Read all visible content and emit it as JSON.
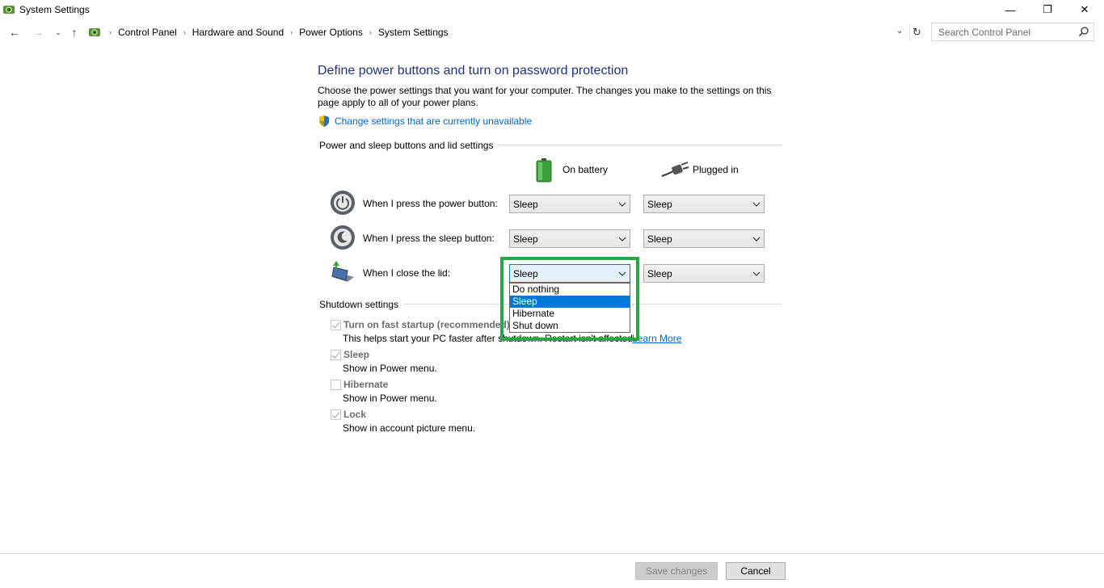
{
  "window": {
    "title": "System Settings",
    "minimize_glyph": "—",
    "maximize_glyph": "❐",
    "close_glyph": "✕"
  },
  "navigation": {
    "back_glyph": "←",
    "forward_glyph": "→",
    "recent_glyph": "⌄",
    "up_glyph": "↑",
    "breadcrumbs": [
      "Control Panel",
      "Hardware and Sound",
      "Power Options",
      "System Settings"
    ],
    "separator": "›",
    "dropdown_glyph": "⌄",
    "refresh_glyph": "↻"
  },
  "search": {
    "placeholder": "Search Control Panel",
    "icon": "search-icon"
  },
  "main": {
    "title": "Define power buttons and turn on password protection",
    "description": "Choose the power settings that you want for your computer. The changes you make to the settings on this page apply to all of your power plans.",
    "change_link": "Change settings that are currently unavailable"
  },
  "power_section": {
    "header": "Power and sleep buttons and lid settings",
    "columns": {
      "battery": "On battery",
      "plugged": "Plugged in"
    },
    "rows": [
      {
        "label": "When I press the power button:",
        "battery": "Sleep",
        "plugged": "Sleep",
        "icon": "power-button-icon"
      },
      {
        "label": "When I press the sleep button:",
        "battery": "Sleep",
        "plugged": "Sleep",
        "icon": "sleep-button-icon"
      },
      {
        "label": "When I close the lid:",
        "battery": "Sleep",
        "plugged": "Sleep",
        "icon": "laptop-lid-icon"
      }
    ],
    "open_dropdown": {
      "options": [
        "Do nothing",
        "Sleep",
        "Hibernate",
        "Shut down"
      ],
      "selected": "Sleep"
    }
  },
  "shutdown_section": {
    "header": "Shutdown settings",
    "items": [
      {
        "label": "Turn on fast startup (recommended)",
        "checked": true,
        "description": "This helps start your PC faster after shutdown. Restart isn't affected.",
        "link": "Learn More"
      },
      {
        "label": "Sleep",
        "checked": true,
        "description": "Show in Power menu."
      },
      {
        "label": "Hibernate",
        "checked": false,
        "description": "Show in Power menu."
      },
      {
        "label": "Lock",
        "checked": true,
        "description": "Show in account picture menu."
      }
    ]
  },
  "footer": {
    "save_label": "Save changes",
    "cancel_label": "Cancel"
  },
  "colors": {
    "title_blue": "#1e3287",
    "link_blue": "#0066cc",
    "selection_blue": "#0078d7",
    "highlight_green": "#28a745"
  }
}
